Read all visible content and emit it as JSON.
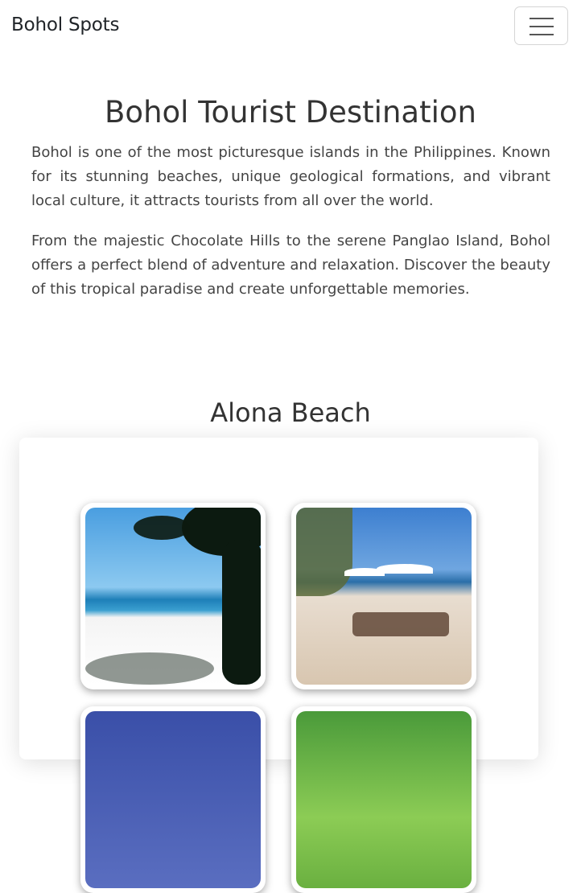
{
  "navbar": {
    "brand": "Bohol Spots",
    "toggler_icon": "hamburger-menu-icon"
  },
  "intro": {
    "title": "Bohol Tourist Destination",
    "paragraph1": "Bohol is one of the most picturesque islands in the Philippines. Known for its stunning beaches, unique geological formations, and vibrant local culture, it attracts tourists from all over the world.",
    "paragraph2": "From the majestic Chocolate Hills to the serene Panglao Island, Bohol offers a perfect blend of adventure and relaxation. Discover the beauty of this tropical paradise and create unforgettable memories."
  },
  "section": {
    "title": "Alona Beach",
    "photos": [
      "beach-palm-photo",
      "beach-umbrellas-photo",
      "beach-sunset-photo",
      "palm-leaves-photo"
    ]
  }
}
